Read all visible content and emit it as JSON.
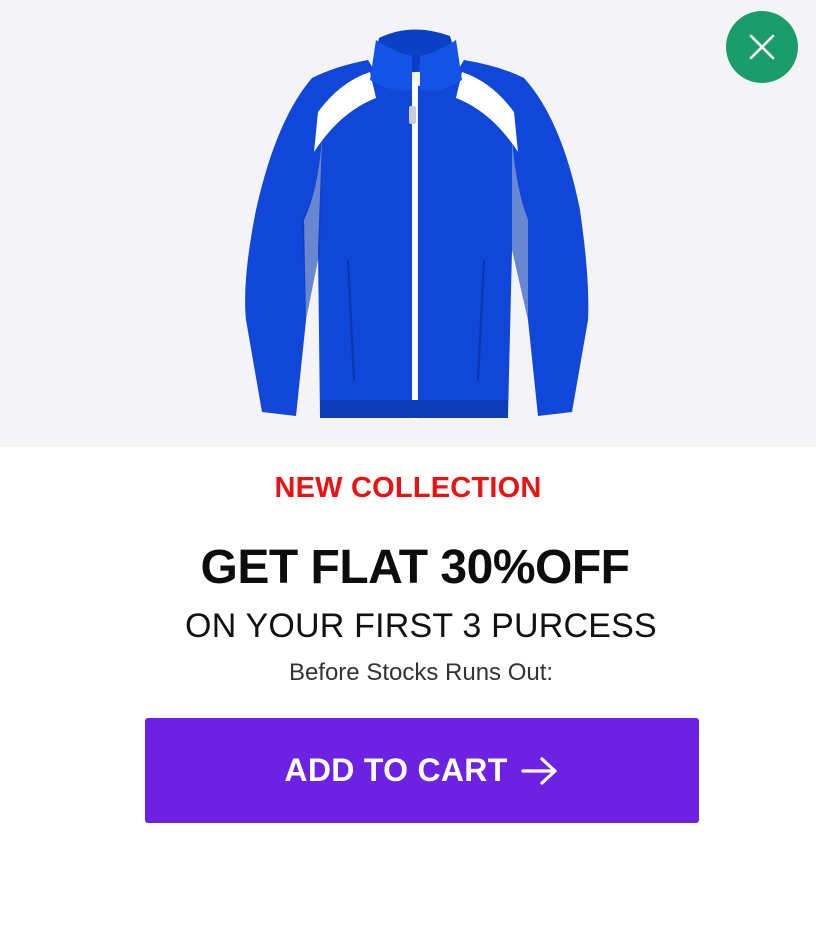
{
  "hero": {
    "image_alt": "Blue track jacket with white stripes",
    "background": "#f4f4f6",
    "jacket_color": "#1047d8"
  },
  "close": {
    "icon": "close-icon",
    "color": "#1a9c6d"
  },
  "offer": {
    "eyebrow": "NEW COLLECTION",
    "headline": "GET FLAT 30%OFF",
    "subhead": "ON YOUR FIRST 3 PURCESS",
    "note": "Before Stocks Runs Out:"
  },
  "cta": {
    "label": "ADD TO CART",
    "icon": "arrow-right-icon",
    "color": "#6d22e3"
  },
  "colors": {
    "eyebrow": "#ea1212",
    "headline": "#0d0d0d"
  }
}
